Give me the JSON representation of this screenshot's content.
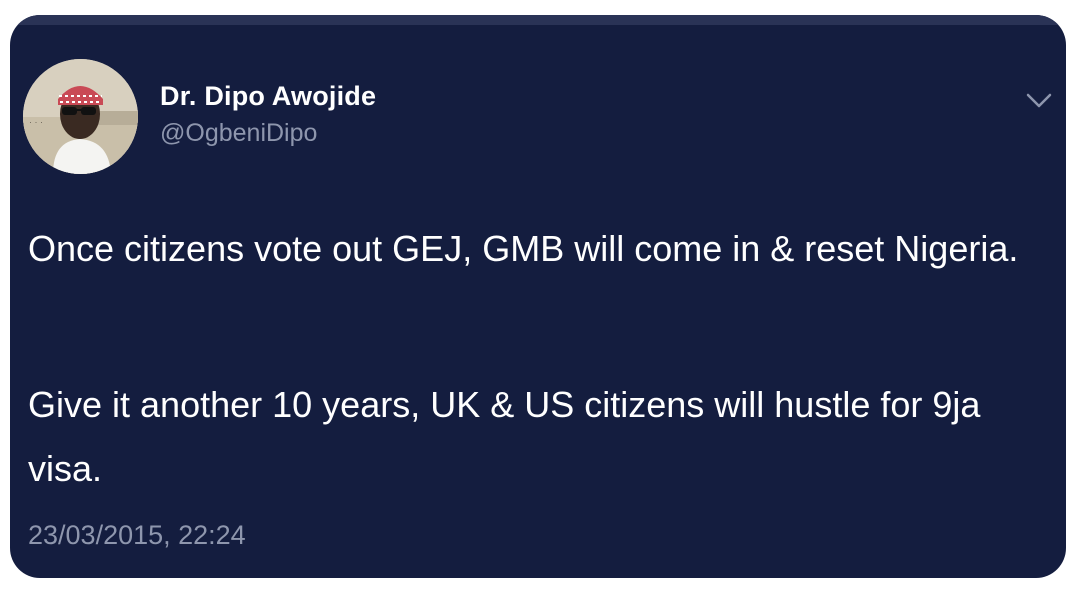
{
  "tweet": {
    "display_name": "Dr. Dipo Awojide",
    "handle": "@OgbeniDipo",
    "paragraphs": [
      "Once citizens vote out GEJ, GMB will come in & reset Nigeria.",
      "Give it another 10 years, UK & US citizens will hustle for 9ja visa."
    ],
    "timestamp": "23/03/2015, 22:24"
  },
  "icons": {
    "menu": "chevron-down-icon",
    "avatar": "profile-photo"
  },
  "colors": {
    "card_background": "#141d3f",
    "primary_text": "#ffffff",
    "secondary_text": "#8e96ad"
  }
}
